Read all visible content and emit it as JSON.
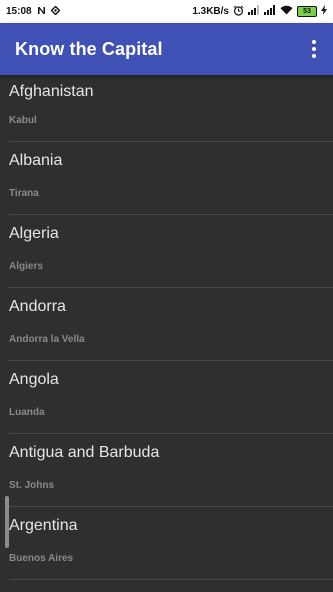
{
  "status_bar": {
    "time": "15:08",
    "network_speed": "1.3KB/s",
    "battery_level": "53",
    "left_icons": [
      "notification-n-icon",
      "location-diamond-icon"
    ],
    "right_icons": [
      "alarm-icon",
      "signal-icon",
      "signal-icon",
      "wifi-icon",
      "battery-icon",
      "charging-icon"
    ]
  },
  "app_bar": {
    "title": "Know the Capital",
    "menu_icon": "more-vert-icon",
    "color": "#3f51b5"
  },
  "countries": [
    {
      "country": "Afghanistan",
      "capital": "Kabul"
    },
    {
      "country": "Albania",
      "capital": "Tirana"
    },
    {
      "country": "Algeria",
      "capital": "Algiers"
    },
    {
      "country": "Andorra",
      "capital": "Andorra la Vella"
    },
    {
      "country": "Angola",
      "capital": "Luanda"
    },
    {
      "country": "Antigua and Barbuda",
      "capital": "St. Johns"
    },
    {
      "country": "Argentina",
      "capital": "Buenos Aires"
    }
  ]
}
